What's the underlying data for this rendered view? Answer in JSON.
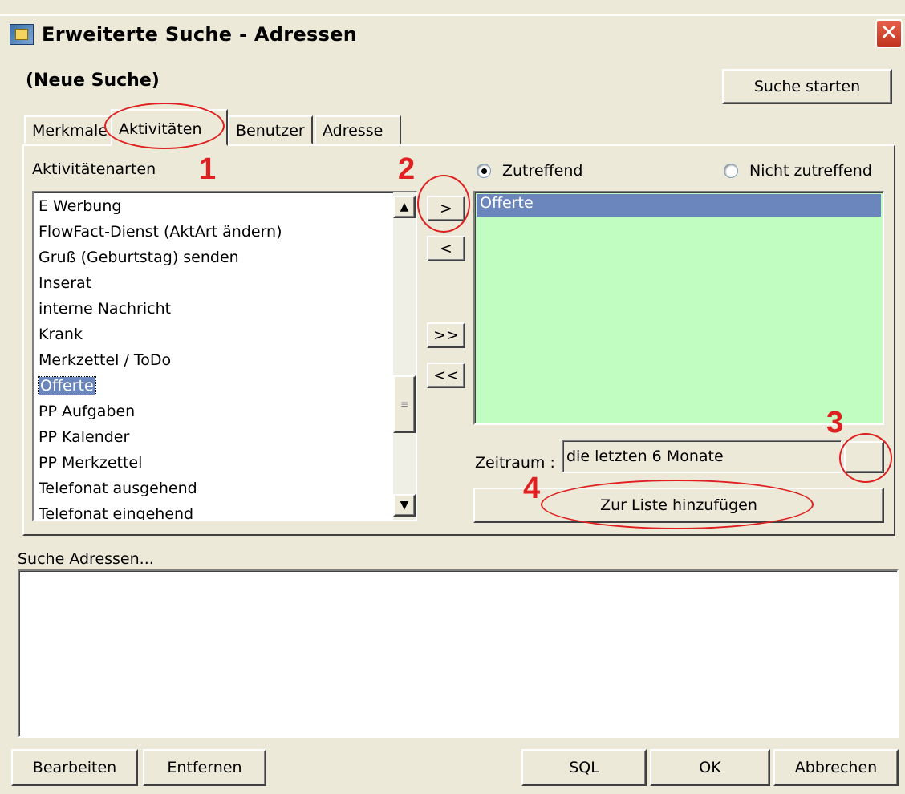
{
  "window": {
    "title": "Erweiterte Suche - Adressen",
    "close_glyph": "✕"
  },
  "header": {
    "subtitle": "(Neue Suche)",
    "start_search_label": "Suche starten"
  },
  "tabs": [
    {
      "label": "Merkmale"
    },
    {
      "label": "Aktivitäten",
      "active": true
    },
    {
      "label": "Benutzer"
    },
    {
      "label": "Adresse"
    }
  ],
  "activities": {
    "label": "Aktivitätenarten",
    "items": [
      "E Werbung",
      "FlowFact-Dienst (AktArt ändern)",
      "Gruß (Geburtstag) senden",
      "Inserat",
      "interne Nachricht",
      "Krank",
      "Merkzettel / ToDo",
      "Offerte",
      "PP Aufgaben",
      "PP Kalender",
      "PP Merkzettel",
      "Telefonat ausgehend",
      "Telefonat eingehend"
    ],
    "selected": "Offerte"
  },
  "transfer": {
    "add_one": ">",
    "remove_one": "<",
    "add_all": ">>",
    "remove_all": "<<"
  },
  "match": {
    "matching_label": "Zutreffend",
    "not_matching_label": "Nicht zutreffend",
    "selected": "Zutreffend"
  },
  "selected_list": {
    "items": [
      "Offerte"
    ]
  },
  "period": {
    "label": "Zeitraum :",
    "value": "die letzten 6 Monate"
  },
  "add_to_list_label": "Zur Liste hinzufügen",
  "results": {
    "label": "Suche Adressen..."
  },
  "footer": {
    "edit_label": "Bearbeiten",
    "remove_label": "Entfernen",
    "sql_label": "SQL",
    "ok_label": "OK",
    "cancel_label": "Abbrechen"
  },
  "annotations": {
    "n1": "1",
    "n2": "2",
    "n3": "3",
    "n4": "4"
  },
  "colors": {
    "dialog_bg": "#ece9d8",
    "selected_list_bg": "#c1fcc1",
    "selection": "#6b86bd",
    "annotation": "#e02020"
  }
}
